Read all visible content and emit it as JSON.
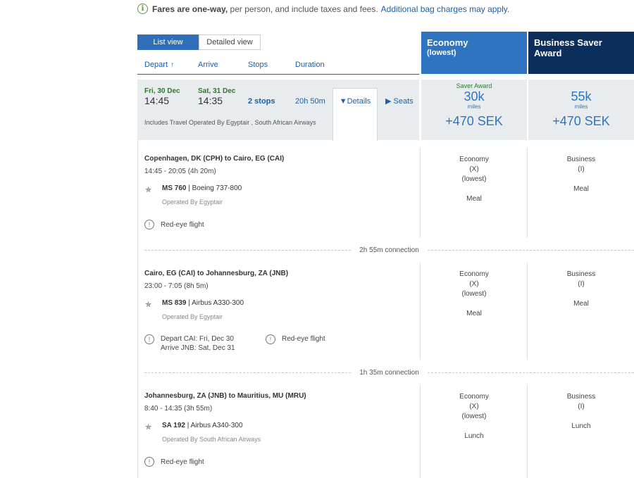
{
  "notice": {
    "bold": "Fares are one-way,",
    "text": "per person, and include taxes and fees.",
    "link": "Additional bag charges may apply."
  },
  "view_toggle": {
    "list": "List view",
    "detailed": "Detailed view"
  },
  "sort": {
    "depart": "Depart",
    "arrive": "Arrive",
    "stops": "Stops",
    "duration": "Duration"
  },
  "fare_headers": {
    "economy": {
      "title": "Economy",
      "sub": "(lowest)"
    },
    "business": {
      "title": "Business Saver Award"
    }
  },
  "flight": {
    "depart_date": "Fri, 30 Dec",
    "depart_time": "14:45",
    "arrive_date": "Sat, 31 Dec",
    "arrive_time": "14:35",
    "stops": "2 stops",
    "duration": "20h 50m",
    "details_label": "Details",
    "seats_label": "Seats",
    "includes": "Includes Travel Operated By Egyptair , South African Airways"
  },
  "prices": {
    "economy": {
      "label": "Saver Award",
      "miles": "30k",
      "miles_unit": "miles",
      "sek": "+470 SEK"
    },
    "business": {
      "miles": "55k",
      "miles_unit": "miles",
      "sek": "+470 SEK"
    }
  },
  "segments": [
    {
      "route": "Copenhagen, DK (CPH) to Cairo, EG (CAI)",
      "time": "14:45 - 20:05 (4h 20m)",
      "flight_no": "MS 760",
      "aircraft": "Boeing 737-800",
      "operated": "Operated By Egyptair",
      "warning": "Red-eye flight",
      "eco": {
        "cabin": "Economy",
        "code": "(X)",
        "tag": "(lowest)",
        "meal": "Meal"
      },
      "bus": {
        "cabin": "Business",
        "code": "(I)",
        "meal": "Meal"
      }
    },
    {
      "route": "Cairo, EG (CAI) to Johannesburg, ZA (JNB)",
      "time": "23:00 - 7:05 (8h 5m)",
      "flight_no": "MS 839",
      "aircraft": "Airbus A330-300",
      "operated": "Operated By Egyptair",
      "depart_note": "Depart CAI: Fri, Dec 30",
      "arrive_note": "Arrive JNB: Sat, Dec 31",
      "warning": "Red-eye flight",
      "eco": {
        "cabin": "Economy",
        "code": "(X)",
        "tag": "(lowest)",
        "meal": "Meal"
      },
      "bus": {
        "cabin": "Business",
        "code": "(I)",
        "meal": "Meal"
      }
    },
    {
      "route": "Johannesburg, ZA (JNB) to Mauritius, MU (MRU)",
      "time": "8:40 - 14:35 (3h 55m)",
      "flight_no": "SA 192",
      "aircraft": "Airbus A340-300",
      "operated": "Operated By South African Airways",
      "warning": "Red-eye flight",
      "eco": {
        "cabin": "Economy",
        "code": "(X)",
        "tag": "(lowest)",
        "meal": "Lunch"
      },
      "bus": {
        "cabin": "Business",
        "code": "(I)",
        "meal": "Lunch"
      }
    }
  ],
  "connections": [
    "2h 55m connection",
    "1h 35m connection"
  ]
}
